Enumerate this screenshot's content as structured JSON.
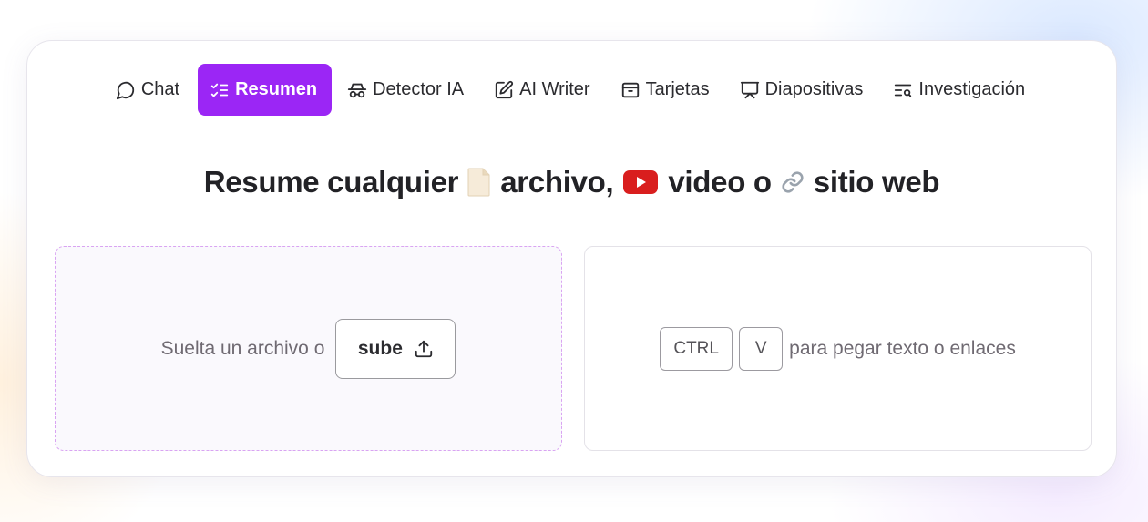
{
  "tabs": [
    {
      "label": "Chat",
      "icon": "chat-bubble-icon",
      "active": false
    },
    {
      "label": "Resumen",
      "icon": "checklist-icon",
      "active": true
    },
    {
      "label": "Detector IA",
      "icon": "spy-glasses-icon",
      "active": false
    },
    {
      "label": "AI Writer",
      "icon": "pencil-square-icon",
      "active": false
    },
    {
      "label": "Tarjetas",
      "icon": "cards-icon",
      "active": false
    },
    {
      "label": "Diapositivas",
      "icon": "presentation-icon",
      "active": false
    },
    {
      "label": "Investigación",
      "icon": "text-search-icon",
      "active": false
    }
  ],
  "headline": {
    "part1": "Resume cualquier",
    "part2": "archivo,",
    "part3": "video o",
    "part4": "sitio web",
    "icons": [
      "document-emoji",
      "youtube-emoji",
      "link-emoji"
    ]
  },
  "drop_zone": {
    "text": "Suelta un archivo o",
    "button_label": "sube",
    "button_icon": "upload-icon"
  },
  "paste_zone": {
    "key1": "CTRL",
    "key2": "V",
    "text": "para pegar texto o enlaces"
  },
  "colors": {
    "accent": "#9b26f5",
    "dashed_border": "#d9a4f2",
    "text_dark": "#222226",
    "text_muted": "#6f6a72"
  }
}
